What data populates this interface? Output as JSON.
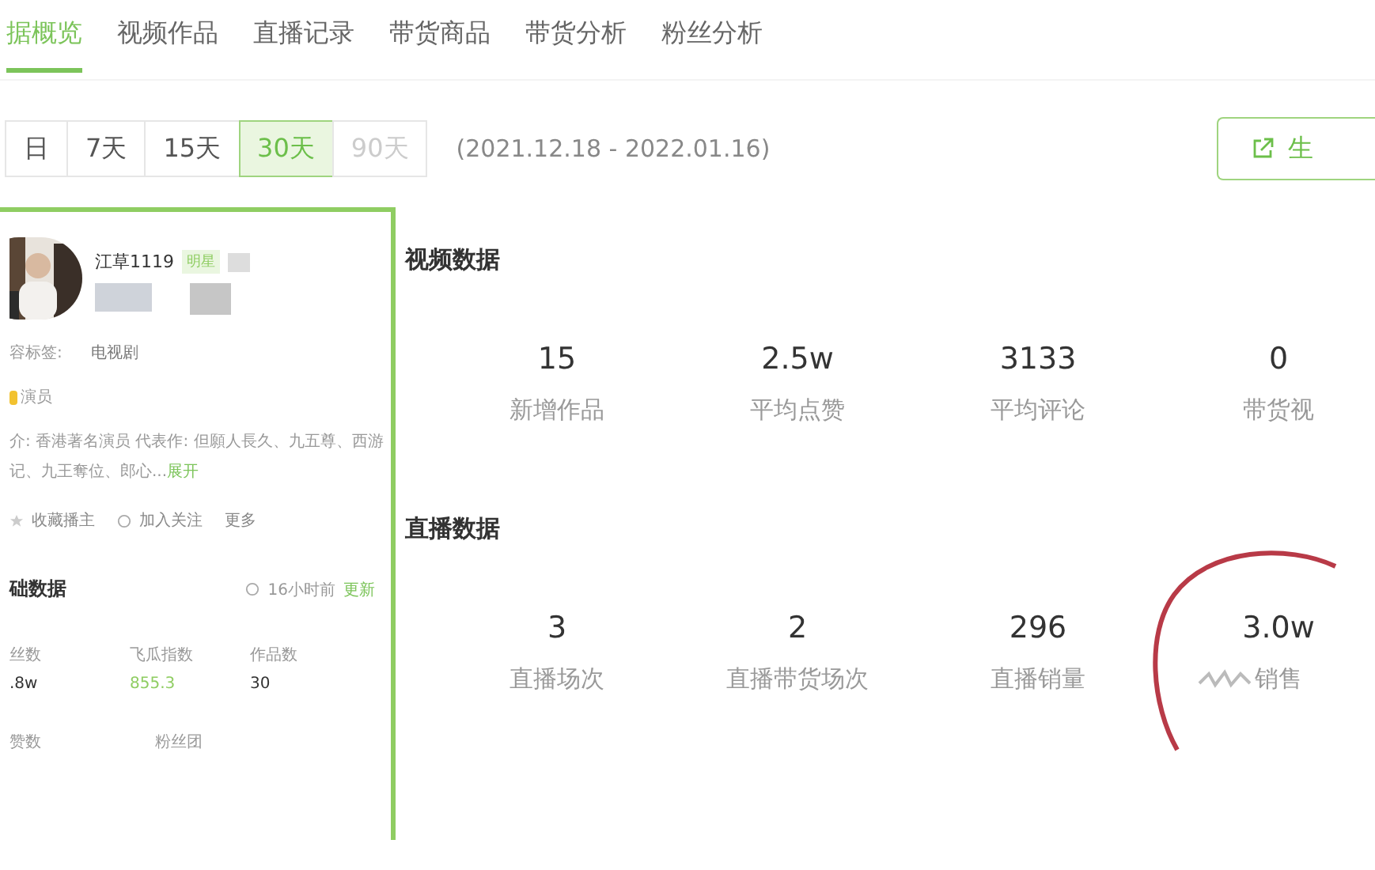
{
  "tabs": [
    {
      "label": "据概览",
      "selected": true
    },
    {
      "label": "视频作品",
      "selected": false
    },
    {
      "label": "直播记录",
      "selected": false
    },
    {
      "label": "带货商品",
      "selected": false
    },
    {
      "label": "带货分析",
      "selected": false
    },
    {
      "label": "粉丝分析",
      "selected": false
    }
  ],
  "periods": [
    {
      "label": "日",
      "selected": false,
      "disabled": false
    },
    {
      "label": "7天",
      "selected": false,
      "disabled": false
    },
    {
      "label": "15天",
      "selected": false,
      "disabled": false
    },
    {
      "label": "30天",
      "selected": true,
      "disabled": false
    },
    {
      "label": "90天",
      "selected": false,
      "disabled": true
    }
  ],
  "date_range": "(2021.12.18 - 2022.01.16)",
  "generate_button": "生",
  "profile": {
    "name": "江草1119",
    "badge": "明星",
    "tag_label": "容标签:",
    "tag": "电视剧",
    "role": "演员",
    "bio": "介: 香港著名演员 代表作: 但願人長久、九五尊、西游记、九王奪位、郎心...",
    "expand": "展开",
    "actions": [
      "收藏播主",
      "加入关注",
      "更多"
    ],
    "basic_title": "础数据",
    "updated": "16小时前",
    "refresh": "更新",
    "stats": [
      {
        "label": "丝数",
        "value": ".8w",
        "kind": "plain"
      },
      {
        "label": "飞瓜指数",
        "value": "855.3",
        "kind": "highlight"
      },
      {
        "label": "作品数",
        "value": "30",
        "kind": "plain"
      }
    ],
    "stats_more": [
      "赞数",
      "粉丝团"
    ]
  },
  "sections": [
    {
      "title": "视频数据",
      "items": [
        {
          "value": "15",
          "label": "新增作品"
        },
        {
          "value": "2.5w",
          "label": "平均点赞"
        },
        {
          "value": "3133",
          "label": "平均评论"
        },
        {
          "value": "0",
          "label": "带货视"
        }
      ]
    },
    {
      "title": "直播数据",
      "items": [
        {
          "value": "3",
          "label": "直播场次"
        },
        {
          "value": "2",
          "label": "直播带货场次"
        },
        {
          "value": "296",
          "label": "直播销量"
        },
        {
          "value": "3.0w",
          "label": "销售"
        }
      ]
    }
  ]
}
